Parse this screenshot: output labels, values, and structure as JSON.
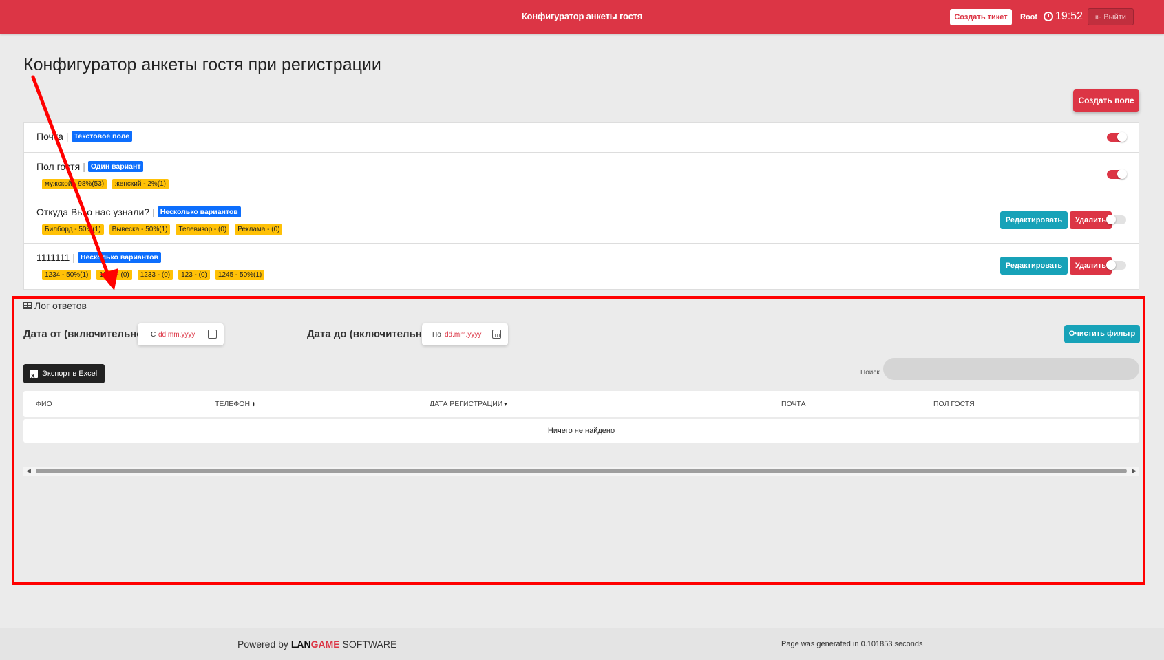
{
  "header": {
    "title": "Конфигуратор анкеты гостя",
    "create_ticket": "Создать тикет",
    "user": "Root",
    "time": "19:52",
    "logout": "Выйти"
  },
  "page": {
    "title": "Конфигуратор анкеты гостя при регистрации",
    "create_field": "Создать поле"
  },
  "fields": [
    {
      "name": "Почта",
      "type": "Текстовое поле",
      "options": [],
      "enabled": true
    },
    {
      "name": "Пол гостя",
      "type": "Один вариант",
      "options": [
        "мужской - 98%(53)",
        "женский - 2%(1)"
      ],
      "enabled": true
    },
    {
      "name": "Откуда Вы о нас узнали?",
      "type": "Несколько вариантов",
      "options": [
        "Билборд - 50%(1)",
        "Вывеска - 50%(1)",
        "Телевизор - (0)",
        "Реклама - (0)"
      ],
      "enabled": false,
      "edit_label": "Редактировать",
      "delete_label": "Удалить"
    },
    {
      "name": "1111111",
      "type": "Несколько вариантов",
      "options": [
        "1234 - 50%(1)",
        "1232 - (0)",
        "1233 - (0)",
        "123 - (0)",
        "1245 - 50%(1)"
      ],
      "enabled": false,
      "edit_label": "Редактировать",
      "delete_label": "Удалить"
    }
  ],
  "log": {
    "title": "Лог ответов",
    "date_from_label": "Дата от (включительно)",
    "date_from_prefix": "С",
    "date_from_placeholder": "dd.mm.yyyy",
    "date_to_label": "Дата до (включительно)",
    "date_to_prefix": "По",
    "date_to_placeholder": "dd.mm.yyyy",
    "clear_filter": "Очистить фильтр",
    "export": "Экспорт в Excel",
    "search_label": "Поиск",
    "search_value": "",
    "columns": [
      "ФИО",
      "ТЕЛЕФОН",
      "ДАТА РЕГИСТРАЦИИ",
      "ПОЧТА",
      "ПОЛ ГОСТЯ"
    ],
    "empty": "Ничего не найдено"
  },
  "footer": {
    "powered_by": "Powered by",
    "brand_lan": "LAN",
    "brand_game": "GAME",
    "brand_software": "SOFTWARE",
    "generated": "Page was generated in 0.101853 seconds"
  },
  "colors": {
    "brand": "#dc3545",
    "info": "#17a2b8",
    "type_badge": "#0d6efd",
    "option_badge": "#ffc107",
    "annotation": "#ff0000"
  }
}
